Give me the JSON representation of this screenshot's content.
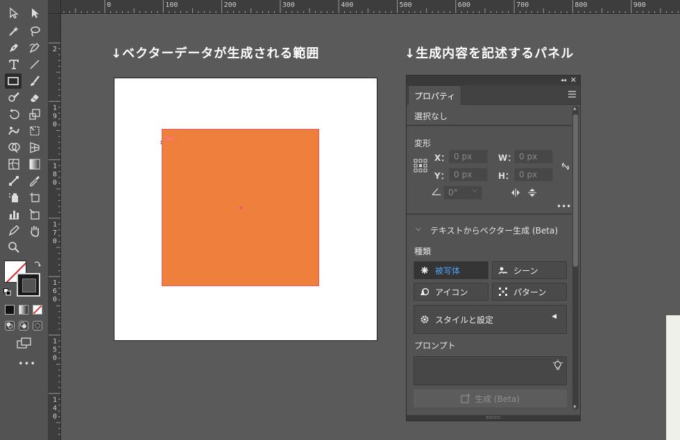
{
  "headings": {
    "left": "↓ベクターデータが生成される範囲",
    "right": "↓生成内容を記述するパネル"
  },
  "ruler": {
    "top_labels": [
      "0",
      "100",
      "200",
      "300",
      "400",
      "500",
      "600",
      "700",
      "800",
      "900"
    ],
    "left_labels": [
      "2",
      "1 9 0",
      "1 8 0",
      "1 7 0",
      "1 6 0",
      "1 5 0",
      "1 4 0"
    ]
  },
  "toolbar": {
    "tools": [
      "selection-tool",
      "direct-selection-tool",
      "magic-wand-tool",
      "lasso-tool",
      "pen-tool",
      "curvature-tool",
      "type-tool",
      "line-tool",
      "rectangle-tool",
      "paintbrush-tool",
      "shaper-tool",
      "eraser-tool",
      "rotate-tool",
      "scale-tool",
      "warp-tool",
      "free-transform-tool",
      "shape-builder-tool",
      "perspective-grid-tool",
      "mesh-tool",
      "gradient-tool",
      "eyedropper-tool",
      "blend-tool",
      "symbol-sprayer-tool",
      "artboard-tool",
      "column-graph-tool",
      "slice-tool",
      "hand-tool",
      "zoom-tool"
    ],
    "more_label": "•••"
  },
  "panel": {
    "tab_label": "プロパティ",
    "selection_status": "選択なし",
    "transform": {
      "title": "変形",
      "x_label": "X：",
      "y_label": "Y：",
      "w_label": "W：",
      "h_label": "H：",
      "x_value": "0 px",
      "y_value": "0 px",
      "w_value": "0 px",
      "h_value": "0 px",
      "angle_value": "0°"
    },
    "text_to_vector": {
      "title": "テキストからベクター生成 (Beta)",
      "type_label": "種類",
      "types": [
        "被写体",
        "シーン",
        "アイコン",
        "パターン"
      ],
      "style_settings": "スタイルと設定",
      "prompt_label": "プロンプト",
      "prompt_value": "",
      "generate_label": "生成 (Beta)"
    }
  },
  "colors": {
    "shape_fill": "#ef7f3c",
    "accent": "#4fa3f7"
  }
}
